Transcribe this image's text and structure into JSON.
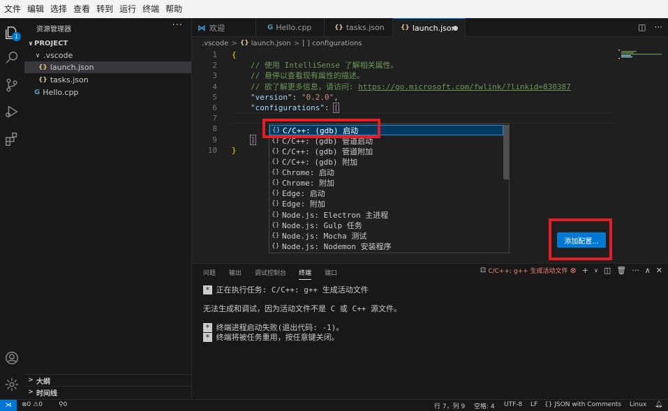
{
  "menu": [
    "文件",
    "编辑",
    "选择",
    "查看",
    "转到",
    "运行",
    "终端",
    "帮助"
  ],
  "activity": {
    "explorer_badge": "1"
  },
  "sidebar": {
    "title": "资源管理器",
    "more": "···",
    "project": "PROJECT",
    "folder": ".vscode",
    "files": [
      "launch.json",
      "tasks.json",
      "Hello.cpp"
    ],
    "outline": "大纲",
    "timeline": "时间线"
  },
  "tabs": [
    {
      "label": "欢迎"
    },
    {
      "label": "Hello.cpp"
    },
    {
      "label": "tasks.json"
    },
    {
      "label": "launch.json"
    }
  ],
  "icons": {
    "json": "{}",
    "cpp": "G"
  },
  "breadcrumb": {
    "folder": ".vscode",
    "file": "launch.json",
    "node_icon": "[ ]",
    "node": "configurations"
  },
  "editor": {
    "line_numbers": [
      "1",
      "2",
      "3",
      "4",
      "5",
      "6",
      "7",
      "8",
      "9",
      "10"
    ],
    "brace_open": "{",
    "comment1": "// 使用 IntelliSense 了解相关属性。",
    "comment2": "// 悬停以查看现有属性的描述。",
    "comment3_prefix": "// 欲了解更多信息，请访问: ",
    "comment3_link": "https://go.microsoft.com/fwlink/?linkid=830387",
    "version_key": "\"version\"",
    "version_colon": ": ",
    "version_val": "\"0.2.0\"",
    "version_comma": ",",
    "config_key": "\"configurations\"",
    "config_colon": ": ",
    "config_bracket": "[",
    "close_bracket": "]",
    "brace_close": "}"
  },
  "suggest": {
    "icon": "{}",
    "items": [
      "C/C++: (gdb) 启动",
      "C/C++: (gdb) 管道启动",
      "C/C++: (gdb) 管道附加",
      "C/C++: (gdb) 附加",
      "Chrome: 启动",
      "Chrome: 附加",
      "Edge: 启动",
      "Edge: 附加",
      "Node.js: Electron 主进程",
      "Node.js: Gulp 任务",
      "Node.js: Mocha 测试",
      "Node.js: Nodemon 安装程序"
    ]
  },
  "add_config_button": "添加配置...",
  "panel": {
    "tabs": [
      "问题",
      "输出",
      "调试控制台",
      "终端",
      "端口"
    ],
    "active_task": "C/C++: g++ 生成活动文件",
    "terminal": {
      "star": "*",
      "line1": "正在执行任务: C/C++: g++ 生成活动文件",
      "line2": "无法生成和调试，因为活动文件不是 C 或 C++ 源文件。",
      "line3": "终端进程启动失败(退出代码: -1)。",
      "line4": "终端将被任务重用，按任意键关闭。"
    }
  },
  "status": {
    "errors": "0",
    "warnings": "0",
    "ports": "0",
    "position": "行 7，列 9",
    "spaces": "空格: 4",
    "encoding": "UTF-8",
    "eol": "LF",
    "language": "JSON with Comments",
    "os": "Linux"
  }
}
